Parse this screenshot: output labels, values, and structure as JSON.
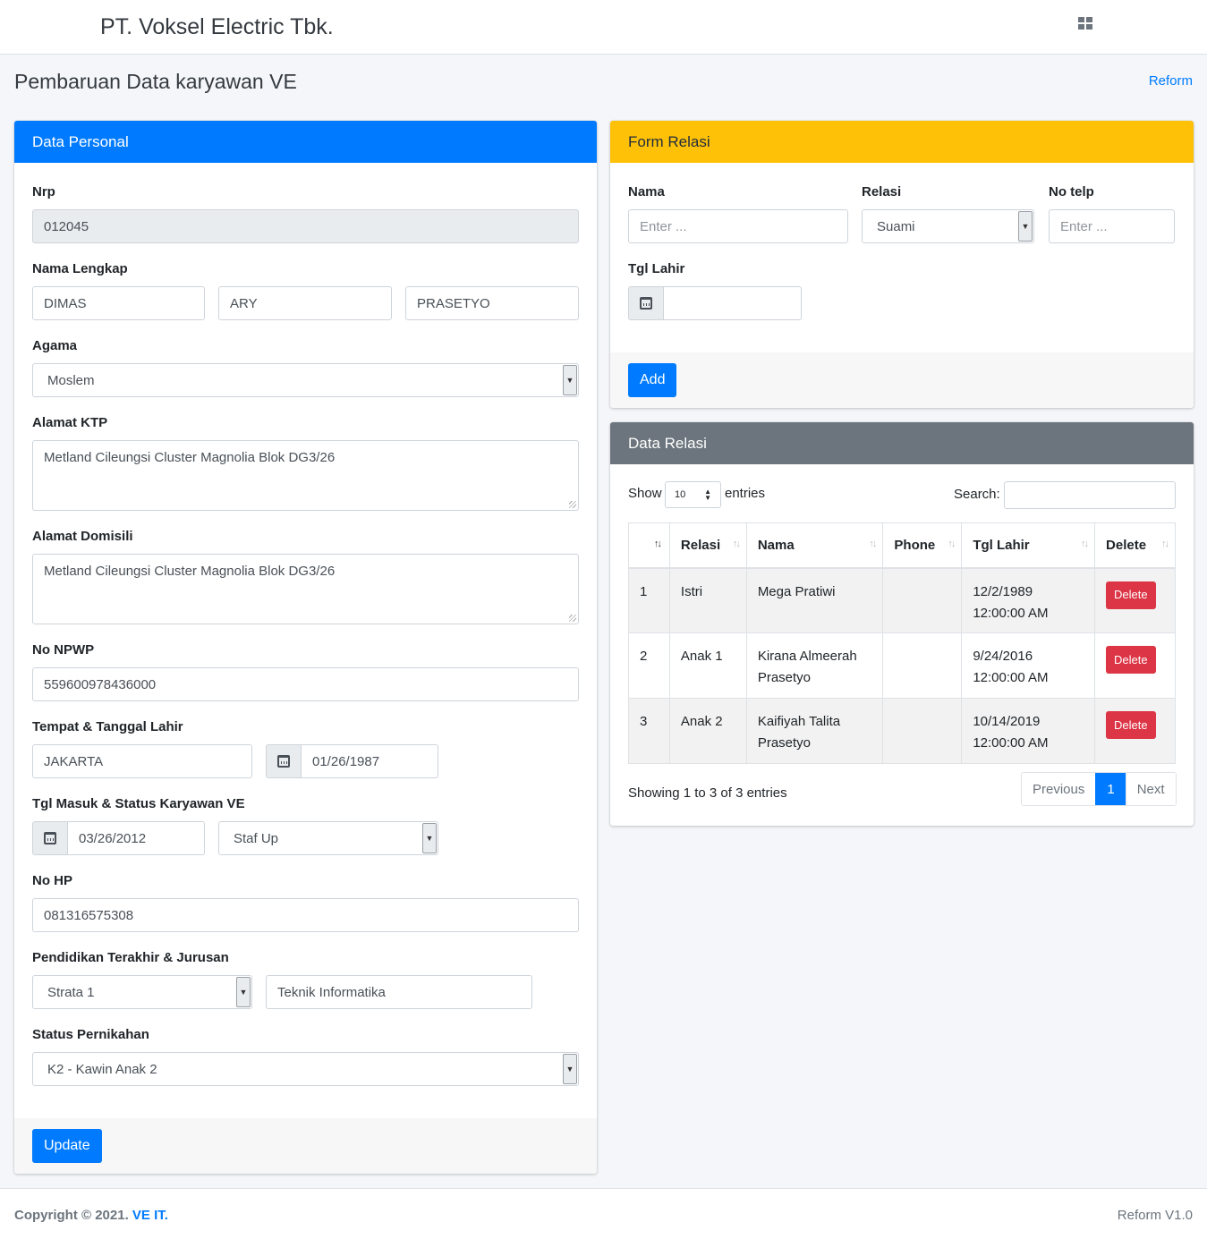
{
  "header": {
    "brand": "PT. Voksel Electric Tbk.",
    "menu_icon": "grid-icon"
  },
  "page": {
    "title": "Pembaruan Data karyawan VE",
    "link": "Reform"
  },
  "personal": {
    "title": "Data Personal",
    "nrp_label": "Nrp",
    "nrp": "012045",
    "nama_label": "Nama Lengkap",
    "first": "DIMAS",
    "middle": "ARY",
    "last": "PRASETYO",
    "agama_label": "Agama",
    "agama": "Moslem",
    "ktp_label": "Alamat KTP",
    "ktp": "Metland Cileungsi Cluster Magnolia Blok DG3/26",
    "domisili_label": "Alamat Domisili",
    "domisili": "Metland Cileungsi Cluster Magnolia Blok DG3/26",
    "npwp_label": "No NPWP",
    "npwp": "559600978436000",
    "lahir_label": "Tempat & Tanggal Lahir",
    "tempat": "JAKARTA",
    "tanggal": "01/26/1987",
    "masuk_label": "Tgl Masuk & Status Karyawan VE",
    "masuk": "03/26/2012",
    "status": "Staf Up",
    "hp_label": "No HP",
    "hp": "081316575308",
    "pendidikan_label": "Pendidikan Terakhir & Jurusan",
    "pendidikan": "Strata 1",
    "jurusan": "Teknik Informatika",
    "nikah_label": "Status Pernikahan",
    "nikah": "K2 - Kawin Anak 2",
    "update_button": "Update"
  },
  "form_relasi": {
    "title": "Form Relasi",
    "nama_label": "Nama",
    "nama_placeholder": "Enter ...",
    "relasi_label": "Relasi",
    "relasi": "Suami",
    "telp_label": "No telp",
    "telp_placeholder": "Enter ...",
    "tgl_label": "Tgl Lahir",
    "add_button": "Add"
  },
  "data_relasi": {
    "title": "Data Relasi",
    "show_label": "Show",
    "page_size": "10",
    "entries_label": "entries",
    "search_label": "Search:",
    "columns": [
      "",
      "Relasi",
      "Nama",
      "Phone",
      "Tgl Lahir",
      "Delete"
    ],
    "rows": [
      {
        "no": "1",
        "relasi": "Istri",
        "nama": "Mega Pratiwi",
        "phone": "",
        "tgl1": "12/2/1989",
        "tgl2": "12:00:00 AM",
        "action": "Delete"
      },
      {
        "no": "2",
        "relasi": "Anak 1",
        "nama1": "Kirana Almeerah",
        "nama2": "Prasetyo",
        "phone": "",
        "tgl1": "9/24/2016",
        "tgl2": "12:00:00 AM",
        "action": "Delete"
      },
      {
        "no": "3",
        "relasi": "Anak 2",
        "nama1": "Kaifiyah Talita",
        "nama2": "Prasetyo",
        "phone": "",
        "tgl1": "10/14/2019",
        "tgl2": "12:00:00 AM",
        "action": "Delete"
      }
    ],
    "info": "Showing 1 to 3 of 3 entries",
    "pager": {
      "prev": "Previous",
      "current": "1",
      "next": "Next"
    }
  },
  "footer": {
    "copy_prefix": "Copyright © 2021. ",
    "copy_link": "VE IT.",
    "version": "Reform V1.0"
  },
  "colors": {
    "primary": "#007bff",
    "warning": "#ffc107",
    "secondary": "#6c757d",
    "danger": "#dc3545"
  }
}
